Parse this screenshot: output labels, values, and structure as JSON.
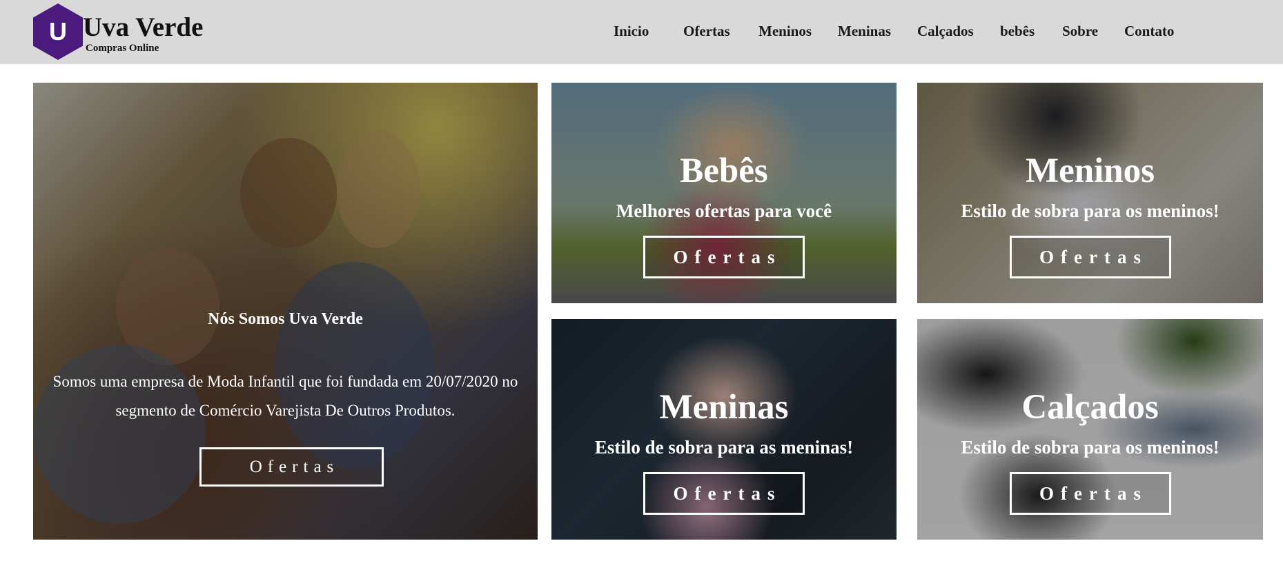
{
  "brand": {
    "logo_letter": "U",
    "name": "Uva Verde",
    "tagline": "Compras Online",
    "logo_color": "#4b1a7f"
  },
  "nav": {
    "items": [
      {
        "label": "Inicio"
      },
      {
        "label": "Ofertas"
      },
      {
        "label": "Meninos"
      },
      {
        "label": "Meninas"
      },
      {
        "label": "Calçados"
      },
      {
        "label": "bebês"
      },
      {
        "label": "Sobre"
      },
      {
        "label": "Contato"
      }
    ]
  },
  "hero": {
    "title": "Nós Somos Uva Verde",
    "text": "Somos uma empresa de Moda Infantil que foi fundada em 20/07/2020 no segmento de Comércio Varejista De Outros Produtos.",
    "button_label": "Ofertas"
  },
  "tiles": [
    {
      "title": "Bebês",
      "subtitle": "Melhores ofertas para você",
      "button_label": "Ofertas"
    },
    {
      "title": "Meninos",
      "subtitle": "Estilo de sobra para os meninos!",
      "button_label": "Ofertas"
    },
    {
      "title": "Meninas",
      "subtitle": "Estilo de sobra para as meninas!",
      "button_label": "Ofertas"
    },
    {
      "title": "Calçados",
      "subtitle": "Estilo de sobra para os meninos!",
      "button_label": "Ofertas"
    }
  ],
  "colors": {
    "header_bg": "#d9d9d9",
    "page_bg": "#ffffff",
    "text_on_image": "#ffffff"
  }
}
